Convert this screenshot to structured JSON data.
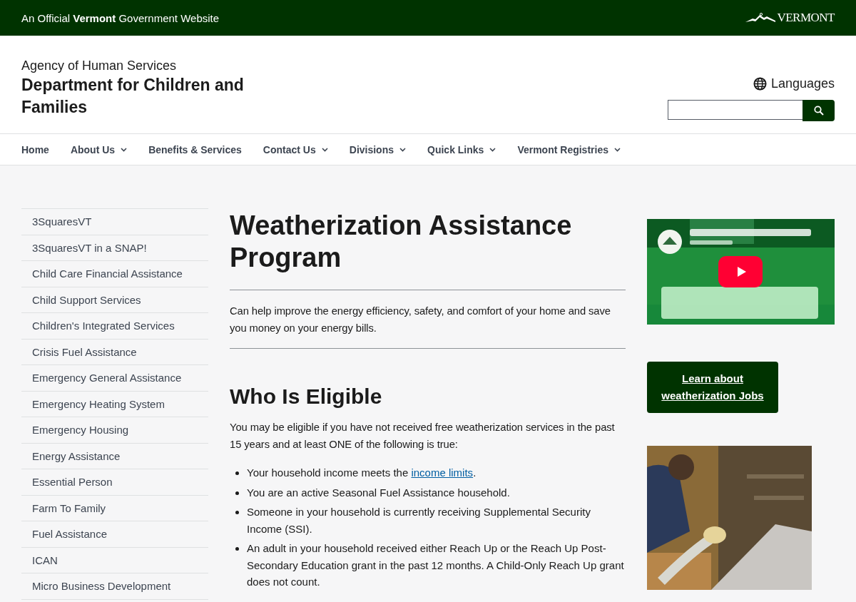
{
  "banner": {
    "text": "An Official **Vermont** Government Website",
    "logo": "VERMONT"
  },
  "header": {
    "agency": "Agency of Human Services",
    "department": "Department for Children and Families",
    "languages": "Languages"
  },
  "nav": [
    {
      "label": "Home",
      "dropdown": false
    },
    {
      "label": "About Us",
      "dropdown": true
    },
    {
      "label": "Benefits & Services",
      "dropdown": false
    },
    {
      "label": "Contact Us",
      "dropdown": true
    },
    {
      "label": "Divisions",
      "dropdown": true
    },
    {
      "label": "Quick Links",
      "dropdown": true
    },
    {
      "label": "Vermont Registries",
      "dropdown": true
    }
  ],
  "sidebar": {
    "items": [
      "3SquaresVT",
      "3SquaresVT in a SNAP!",
      "Child Care Financial Assistance",
      "Child Support Services",
      "Children's Integrated Services",
      "Crisis Fuel Assistance",
      "Emergency General Assistance",
      "Emergency Heating System",
      "Emergency Housing",
      "Energy Assistance",
      "Essential Person",
      "Farm To Family",
      "Fuel Assistance",
      "ICAN",
      "Micro Business Development"
    ]
  },
  "main": {
    "title": "Weatherization Assistance Program",
    "summary": "Can help improve the energy efficiency, safety, and comfort of your home and save you money on your energy bills.",
    "section": {
      "heading": "Who Is Eligible",
      "intro": "You may be eligible if you have not received free weatherization services in the past 15 years and at least ONE of the following is true:",
      "bullets": [
        {
          "text": "Your household income meets the ",
          "link": "income limits",
          "after": "."
        },
        {
          "text": "You are an active Seasonal Fuel Assistance household."
        },
        {
          "text": "Someone in your household is currently receiving Supplemental Security Income (SSI)."
        },
        {
          "text": "An adult in your household received either Reach Up or the Reach Up Post-Secondary Education grant in the past 12 months. A Child-Only Reach Up grant does not count."
        }
      ]
    }
  },
  "aside": {
    "jobs_button": "Learn about weatherization Jobs"
  }
}
